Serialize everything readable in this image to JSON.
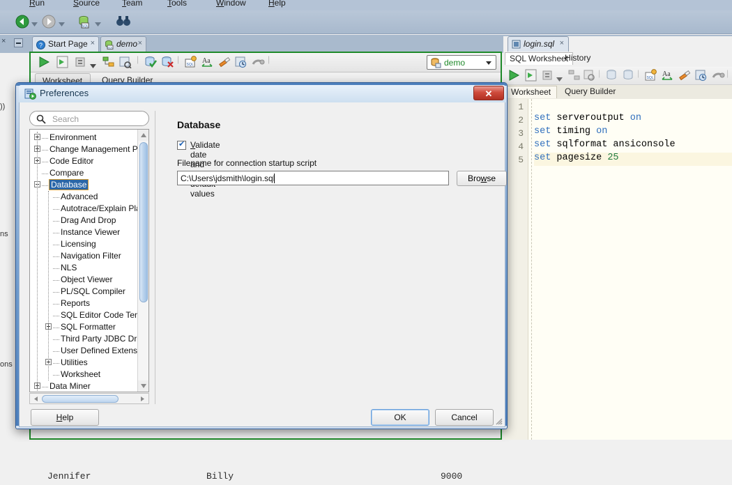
{
  "app": {
    "menubar": [
      "Run",
      "Source",
      "Team",
      "Tools",
      "Window",
      "Help"
    ],
    "editor_tabs": [
      {
        "label": "Start Page",
        "icon": "help-circle-icon",
        "close": "×"
      },
      {
        "label": "demo",
        "icon": "connection-icon",
        "close": "×"
      }
    ],
    "connection": {
      "name": "demo",
      "icon": "database-connection-icon"
    },
    "worksheet_subtabs": [
      "Worksheet",
      "Query Builder"
    ],
    "background_grid_row": [
      "Jennifer",
      "Billy",
      "9000"
    ]
  },
  "right_editor": {
    "tab": {
      "label": "login.sql",
      "close": "×"
    },
    "panel_tabs": [
      "SQL Worksheet",
      "History"
    ],
    "sub_tabs": [
      "Worksheet",
      "Query Builder"
    ],
    "line_numbers": [
      "1",
      "2",
      "3",
      "4",
      "5"
    ],
    "code": [
      {
        "n": "1",
        "tokens": []
      },
      {
        "n": "2",
        "tokens": [
          {
            "t": "set",
            "c": "kw"
          },
          {
            "t": " serveroutput ",
            "c": ""
          },
          {
            "t": "on",
            "c": "kw"
          }
        ]
      },
      {
        "n": "3",
        "tokens": [
          {
            "t": "set",
            "c": "kw"
          },
          {
            "t": " timing ",
            "c": ""
          },
          {
            "t": "on",
            "c": "kw"
          }
        ]
      },
      {
        "n": "4",
        "tokens": [
          {
            "t": "set",
            "c": "kw"
          },
          {
            "t": " sqlformat ansiconsole",
            "c": ""
          }
        ]
      },
      {
        "n": "5",
        "tokens": [
          {
            "t": "set",
            "c": "kw"
          },
          {
            "t": " pagesize ",
            "c": ""
          },
          {
            "t": "25",
            "c": "num"
          }
        ],
        "highlight": true
      }
    ]
  },
  "dialog": {
    "title": "Preferences",
    "icon": "preferences-icon",
    "close_label": "✕",
    "search": {
      "placeholder": "Search",
      "value": "",
      "icon": "search-icon"
    },
    "tree": [
      {
        "label": "Environment",
        "depth": 0,
        "expander": "plus"
      },
      {
        "label": "Change Management Param",
        "depth": 0,
        "expander": "plus"
      },
      {
        "label": "Code Editor",
        "depth": 0,
        "expander": "plus"
      },
      {
        "label": "Compare",
        "depth": 0,
        "expander": "none"
      },
      {
        "label": "Database",
        "depth": 0,
        "expander": "minus",
        "selected": true
      },
      {
        "label": "Advanced",
        "depth": 1,
        "expander": "none"
      },
      {
        "label": "Autotrace/Explain Plan",
        "depth": 1,
        "expander": "none"
      },
      {
        "label": "Drag And Drop",
        "depth": 1,
        "expander": "none"
      },
      {
        "label": "Instance Viewer",
        "depth": 1,
        "expander": "none"
      },
      {
        "label": "Licensing",
        "depth": 1,
        "expander": "none"
      },
      {
        "label": "Navigation Filter",
        "depth": 1,
        "expander": "none"
      },
      {
        "label": "NLS",
        "depth": 1,
        "expander": "none"
      },
      {
        "label": "Object Viewer",
        "depth": 1,
        "expander": "none"
      },
      {
        "label": "PL/SQL Compiler",
        "depth": 1,
        "expander": "none"
      },
      {
        "label": "Reports",
        "depth": 1,
        "expander": "none"
      },
      {
        "label": "SQL Editor Code Templa",
        "depth": 1,
        "expander": "none"
      },
      {
        "label": "SQL Formatter",
        "depth": 1,
        "expander": "plus"
      },
      {
        "label": "Third Party JDBC Driver",
        "depth": 1,
        "expander": "none"
      },
      {
        "label": "User Defined Extension",
        "depth": 1,
        "expander": "none"
      },
      {
        "label": "Utilities",
        "depth": 1,
        "expander": "plus"
      },
      {
        "label": "Worksheet",
        "depth": 1,
        "expander": "none"
      },
      {
        "label": "Data Miner",
        "depth": 0,
        "expander": "plus"
      }
    ],
    "panel": {
      "heading": "Database",
      "checkbox": {
        "label": "Validate date and time default values",
        "checked": true,
        "accel": "V"
      },
      "field_label": "Filename for connection startup script",
      "field_value": "C:\\Users\\jdsmith\\login.sql",
      "browse_label": "Browse",
      "browse_accel": "w"
    },
    "buttons": {
      "help": "Help",
      "help_accel": "H",
      "ok": "OK",
      "cancel": "Cancel"
    }
  },
  "colors": {
    "dialog_border": "#2d5a96",
    "selection": "#2a66a8",
    "selection_outline": "#d79b2e",
    "keyword": "#2f6fbd",
    "number": "#1f7a3d",
    "connection_text": "#1f8a2a",
    "focus_border": "#1f8a2a",
    "close_button": "#cf4b3c"
  }
}
